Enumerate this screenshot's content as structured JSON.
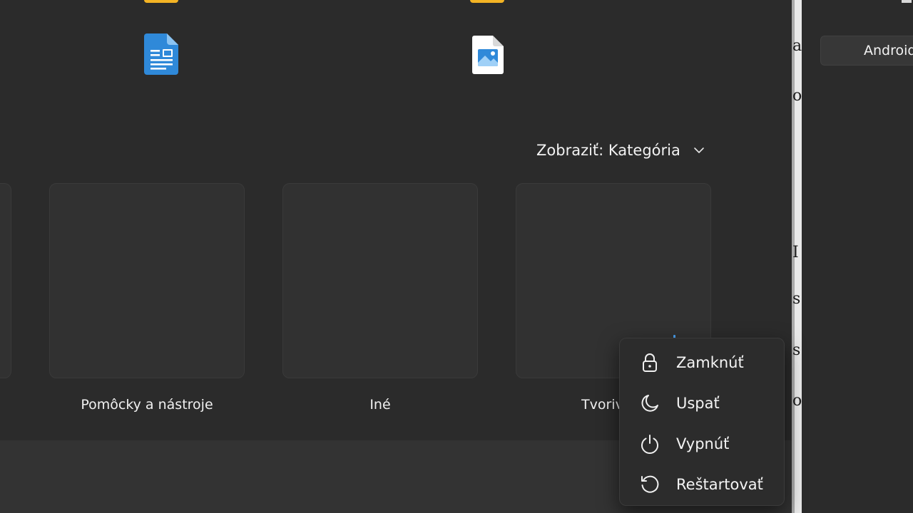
{
  "start_menu": {
    "view_toggle_label": "Zobraziť: Kategória",
    "recommended_files": [
      {
        "icon": "document-icon",
        "color": "#2f89d9"
      },
      {
        "icon": "image-file-icon",
        "color": "#2f89d9"
      }
    ],
    "categories": [
      {
        "label": "Pomôcky a nástroje"
      },
      {
        "label": "Iné"
      },
      {
        "label": "Tvorivosť"
      }
    ]
  },
  "power_menu": {
    "items": [
      {
        "label": "Zamknúť",
        "icon": "lock-icon"
      },
      {
        "label": "Uspať",
        "icon": "sleep-icon"
      },
      {
        "label": "Vypnúť",
        "icon": "power-icon"
      },
      {
        "label": "Reštartovať",
        "icon": "restart-icon"
      }
    ]
  },
  "right_panel": {
    "button_label": "Android"
  },
  "side_strip_glyphs": [
    "a",
    "o",
    "I",
    "s",
    "s",
    "o"
  ],
  "colors": {
    "background": "#202020",
    "panel": "#2b2b2b",
    "folder": "#f3b324",
    "accent": "#2f89d9"
  }
}
